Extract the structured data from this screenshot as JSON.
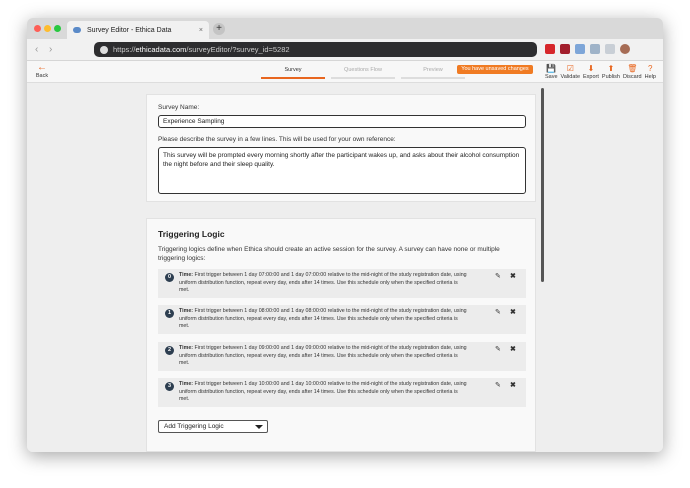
{
  "browser": {
    "tab_title": "Survey Editor - Ethica Data",
    "tab_close": "×",
    "new_tab": "+",
    "url_prefix": "https://",
    "url_host": "ethicadata.com",
    "url_path": "/surveyEditor/?survey_id=5282"
  },
  "appbar": {
    "back_label": "Back",
    "back_icon": "←",
    "steps": [
      {
        "label": "Survey",
        "active": true
      },
      {
        "label": "Questions Flow",
        "active": false
      },
      {
        "label": "Preview",
        "active": false
      }
    ],
    "unsaved_notice": "You have unsaved changes",
    "actions": [
      {
        "label": "Save",
        "icon": "💾"
      },
      {
        "label": "Validate",
        "icon": "☑"
      },
      {
        "label": "Export",
        "icon": "⬇"
      },
      {
        "label": "Publish",
        "icon": "⬆"
      },
      {
        "label": "Discard",
        "icon": "🗑"
      },
      {
        "label": "Help",
        "icon": "?"
      }
    ],
    "accent_color": "#e8661f"
  },
  "survey": {
    "name_label": "Survey Name:",
    "name_value": "Experience Sampling",
    "description_label": "Please describe the survey in a few lines. This will be used for your own reference:",
    "description_value": "This survey will be prompted every morning shortly after the participant wakes up, and asks about their alcohol consumption the night before and their sleep quality."
  },
  "triggering": {
    "heading": "Triggering Logic",
    "description": "Triggering logics define when Ethica should create an active session for the survey. A survey can have none or multiple triggering logics:",
    "items": [
      {
        "index": "0",
        "type": "Time:",
        "text": "First trigger between 1 day 07:00:00 and 1 day 07:00:00 relative to the mid-night of the study registration date, using uniform distribution function, repeat every day, ends after 14 times. Use this schedule only when the specified criteria is met."
      },
      {
        "index": "1",
        "type": "Time:",
        "text": "First trigger between 1 day 08:00:00 and 1 day 08:00:00 relative to the mid-night of the study registration date, using uniform distribution function, repeat every day, ends after 14 times. Use this schedule only when the specified criteria is met."
      },
      {
        "index": "2",
        "type": "Time:",
        "text": "First trigger between 1 day 09:00:00 and 1 day 09:00:00 relative to the mid-night of the study registration date, using uniform distribution function, repeat every day, ends after 14 times. Use this schedule only when the specified criteria is met."
      },
      {
        "index": "3",
        "type": "Time:",
        "text": "First trigger between 1 day 10:00:00 and 1 day 10:00:00 relative to the mid-night of the study registration date, using uniform distribution function, repeat every day, ends after 14 times. Use this schedule only when the specified criteria is met."
      }
    ],
    "edit_icon": "✎",
    "delete_icon": "✖",
    "add_select_value": "Add Triggering Logic"
  }
}
